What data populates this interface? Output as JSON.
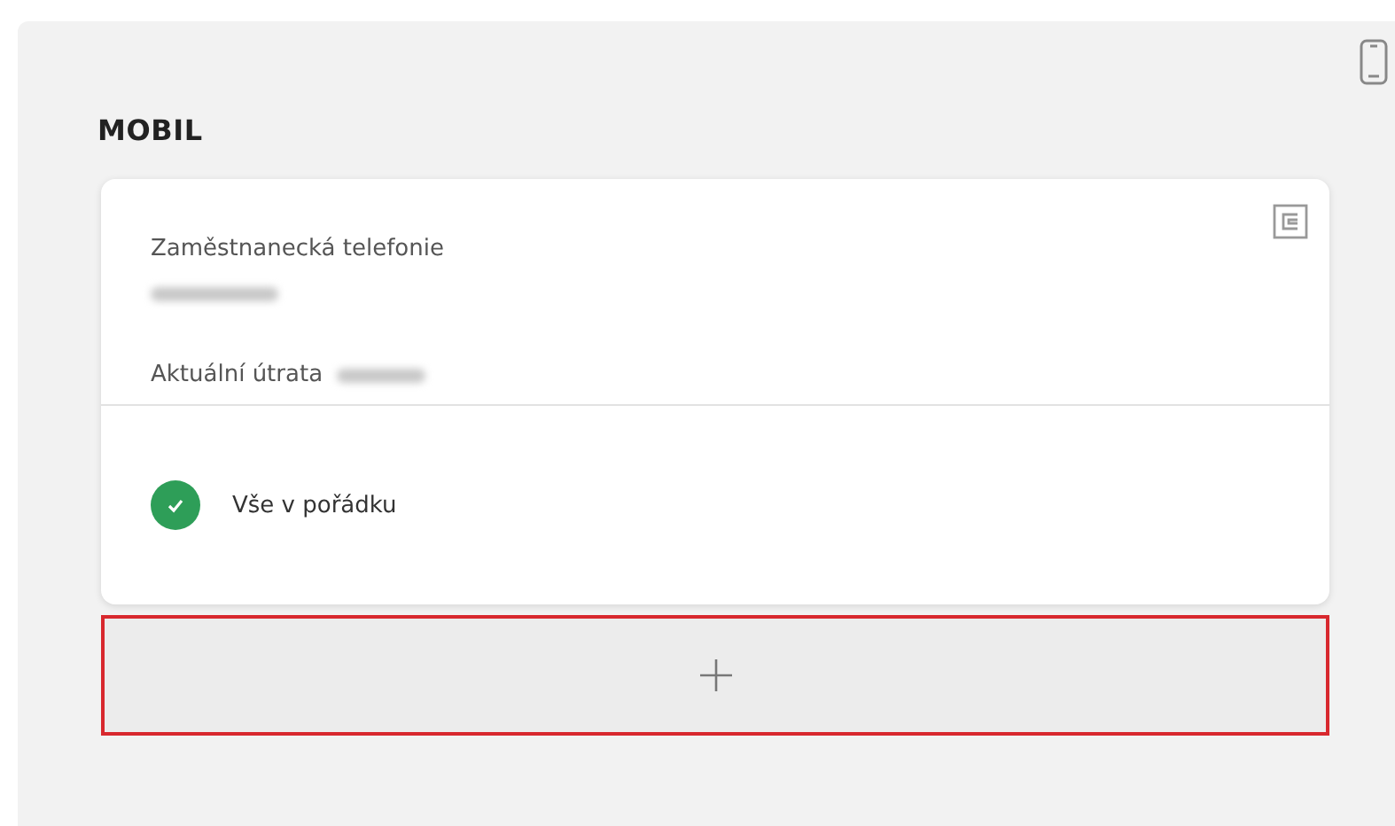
{
  "section": {
    "title": "MOBIL"
  },
  "card": {
    "service": "Zaměstnanecká telefonie",
    "spend_label": "Aktuální útrata",
    "status": {
      "text": "Vše v pořádku",
      "ok": true
    }
  },
  "add_button": {
    "highlighted": true
  }
}
